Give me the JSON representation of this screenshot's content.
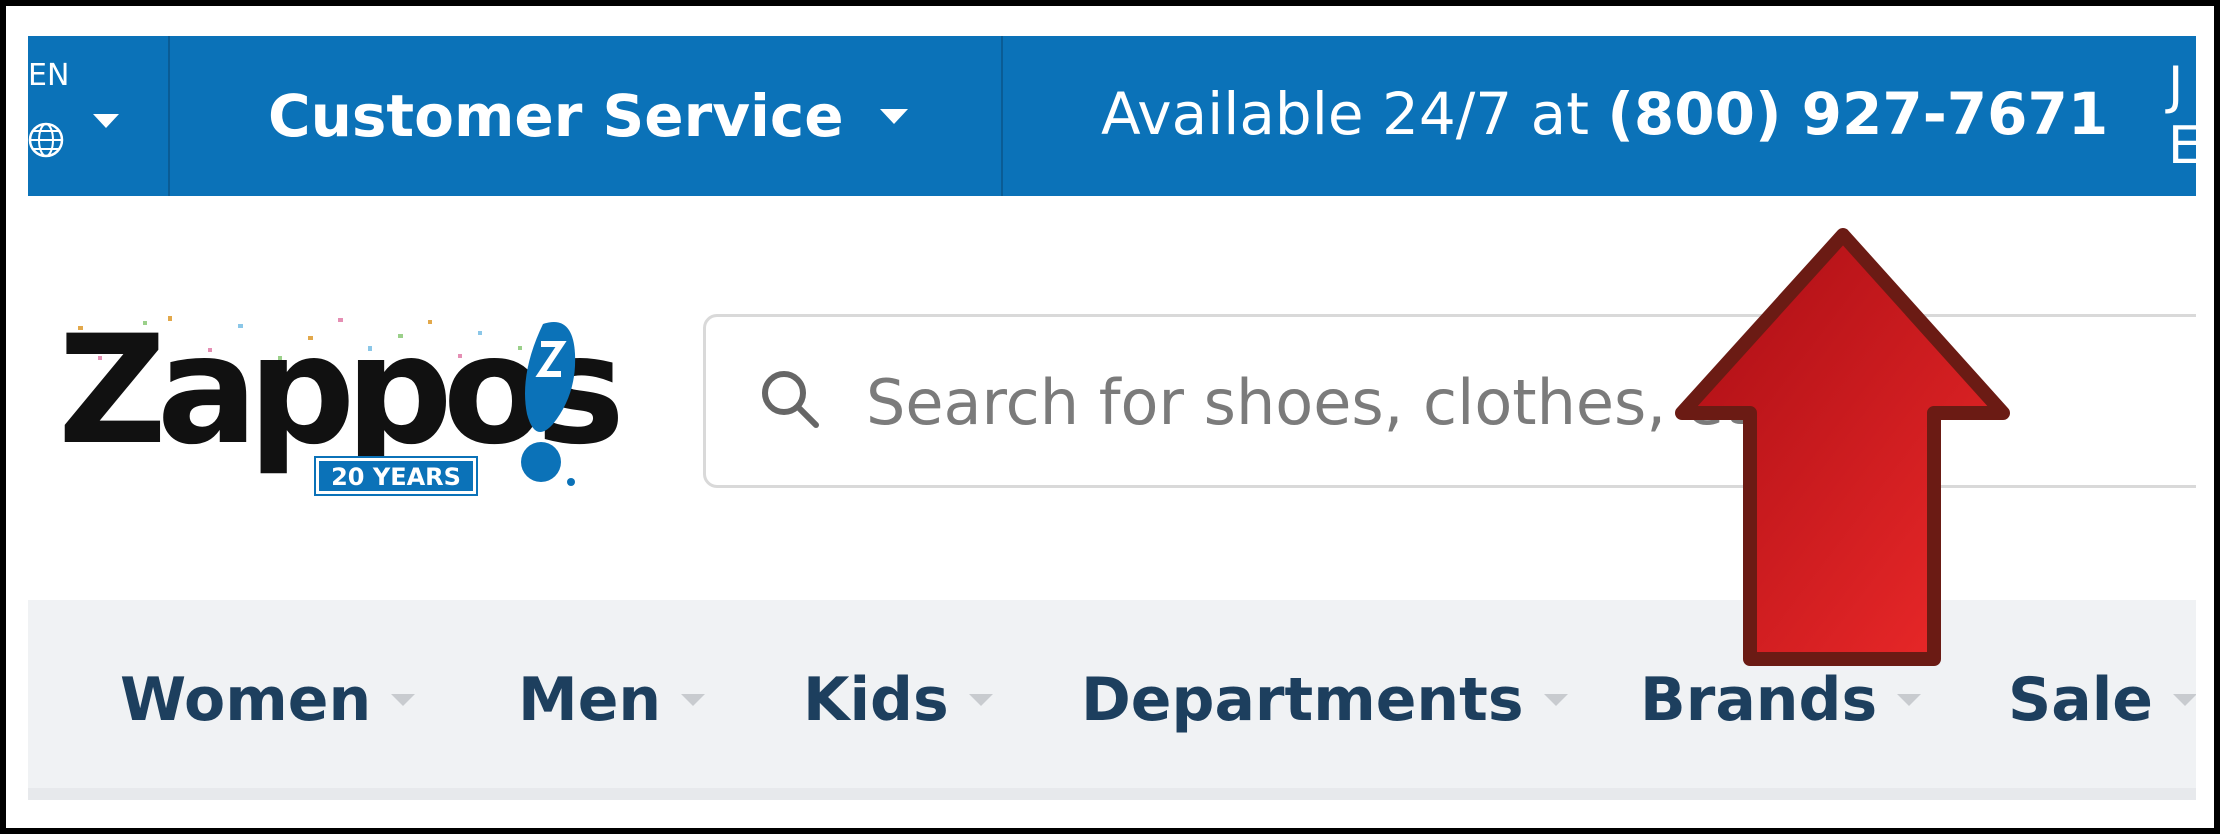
{
  "topbar": {
    "language_code": "EN",
    "customer_service_label": "Customer Service",
    "availability_prefix": "Available 24/7 at ",
    "phone_number": "(800) 927-7671",
    "right_fragment": "J E"
  },
  "logo": {
    "wordmark": "Zappos",
    "badge": "20 YEARS"
  },
  "search": {
    "placeholder": "Search for shoes, clothes, etc."
  },
  "nav": {
    "items": [
      {
        "label": "Women"
      },
      {
        "label": "Men"
      },
      {
        "label": "Kids"
      },
      {
        "label": "Departments"
      },
      {
        "label": "Brands"
      },
      {
        "label": "Sale"
      }
    ]
  },
  "colors": {
    "topbar_bg": "#0b72b8",
    "nav_text": "#1d3f5e",
    "annotation_arrow": "#d41f1f"
  },
  "icons": [
    "globe-icon",
    "chevron-down-icon",
    "search-icon",
    "zappos-mascot-icon",
    "red-arrow-annotation"
  ]
}
